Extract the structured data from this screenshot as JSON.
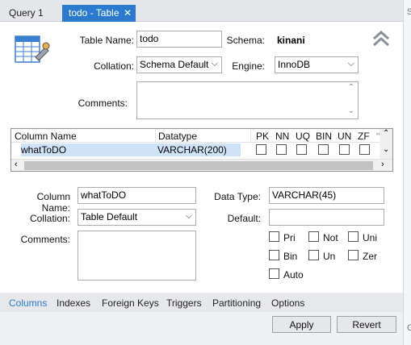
{
  "tabs": [
    {
      "label": "Query 1"
    },
    {
      "label": "todo - Table",
      "close": "✕"
    }
  ],
  "right_strip": {
    "top": "S",
    "bottom": "C"
  },
  "table": {
    "name_label": "Table Name:",
    "name_value": "todo",
    "schema_label": "Schema:",
    "schema_value": "kinani",
    "collation_label": "Collation:",
    "collation_value": "Schema Default",
    "engine_label": "Engine:",
    "engine_value": "InnoDB",
    "comments_label": "Comments:"
  },
  "grid": {
    "headers": [
      "Column Name",
      "Datatype",
      "PK",
      "NN",
      "UQ",
      "BIN",
      "UN",
      "ZF"
    ],
    "rows": [
      {
        "name": "whatToDO",
        "datatype": "VARCHAR(200)"
      }
    ]
  },
  "column": {
    "name_label": "Column Name:",
    "name_value": "whatToDO",
    "datatype_label": "Data Type:",
    "datatype_value": "VARCHAR(45)",
    "collation_label": "Collation:",
    "collation_value": "Table Default",
    "default_label": "Default:",
    "default_value": "",
    "comments_label": "Comments:",
    "flags": [
      "Pri",
      "Not",
      "Uni",
      "Bin",
      "Un",
      "Zer",
      "Auto"
    ]
  },
  "bottom_tabs": [
    "Columns",
    "Indexes",
    "Foreign Keys",
    "Triggers",
    "Partitioning",
    "Options"
  ],
  "buttons": {
    "apply": "Apply",
    "revert": "Revert"
  },
  "colors": {
    "accent": "#2a7bd0",
    "selection": "#cfe3f8"
  },
  "icons": {
    "table": "table-edit-icon",
    "collapse": "double-chevron-up-icon"
  }
}
